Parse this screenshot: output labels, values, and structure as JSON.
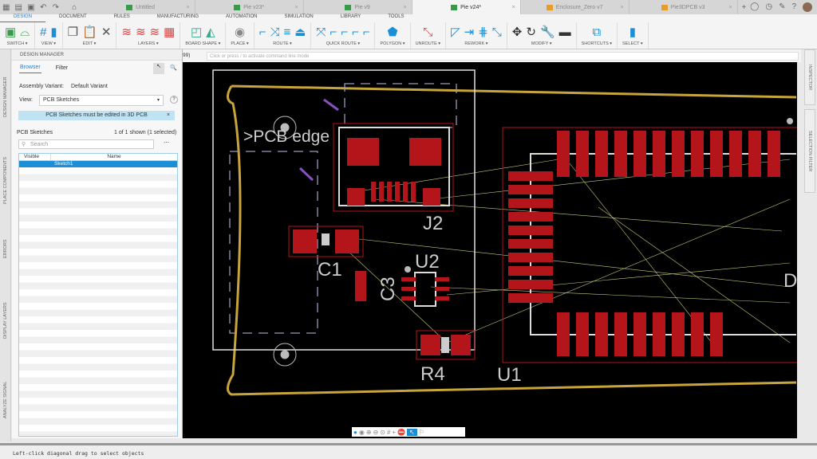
{
  "tabs": [
    {
      "label": "Untitled",
      "active": false
    },
    {
      "label": "Pie v23*",
      "active": false
    },
    {
      "label": "Pie v9",
      "active": false
    },
    {
      "label": "Pie v24*",
      "active": true
    },
    {
      "label": "Enclosure_Zero v7",
      "active": false
    },
    {
      "label": "Pie3DPCB v3",
      "active": false
    }
  ],
  "menu": [
    "DESIGN",
    "DOCUMENT",
    "RULES",
    "MANUFACTURING",
    "AUTOMATION",
    "SIMULATION",
    "LIBRARY",
    "TOOLS"
  ],
  "toolbar": [
    {
      "label": "SWITCH ▾",
      "icons": [
        "▣",
        "⌓"
      ]
    },
    {
      "label": "VIEW ▾",
      "icons": [
        "#",
        "▮"
      ]
    },
    {
      "label": "EDIT ▾",
      "icons": [
        "❐",
        "📋",
        "✕"
      ]
    },
    {
      "label": "LAYERS ▾",
      "icons": [
        "≋",
        "≋",
        "≋",
        "▦"
      ]
    },
    {
      "label": "BOARD SHAPE ▾",
      "icons": [
        "◰",
        "◭"
      ]
    },
    {
      "label": "PLACE ▾",
      "icons": [
        "◉"
      ]
    },
    {
      "label": "ROUTE ▾",
      "icons": [
        "⌐",
        "⤨",
        "≡",
        "⏏"
      ]
    },
    {
      "label": "QUICK ROUTE ▾",
      "icons": [
        "⤧",
        "⌐",
        "⌐",
        "⌐",
        "⌐"
      ]
    },
    {
      "label": "POLYGON ▾",
      "icons": [
        "⬟"
      ]
    },
    {
      "label": "UNROUTE ▾",
      "icons": [
        "⤡"
      ]
    },
    {
      "label": "REWORK ▾",
      "icons": [
        "◸",
        "⇥",
        "⋕",
        "⤡"
      ]
    },
    {
      "label": "MODIFY ▾",
      "icons": [
        "✥",
        "↻",
        "🔧",
        "▬"
      ]
    },
    {
      "label": "SHORTCUTS ▾",
      "icons": [
        "⧉"
      ]
    },
    {
      "label": "SELECT ▾",
      "icons": [
        "▮"
      ]
    }
  ],
  "left_tabs": [
    "DESIGN MANAGER",
    "PLACE COMPONENTS",
    "ERRORS",
    "DISPLAY LAYERS",
    "ANALYZE SIGNAL"
  ],
  "right_tabs": [
    "INSPECTOR",
    "SELECTION FILTER"
  ],
  "panel": {
    "title": "DESIGN MANAGER",
    "tabs": [
      "Browser",
      "Filter"
    ],
    "assembly_label": "Assembly Variant:",
    "assembly_value": "Default Variant",
    "view_label": "View:",
    "view_value": "PCB Sketches",
    "info": "PCB Sketches must be edited in 3D PCB",
    "section": "PCB Sketches",
    "count": "1 of 1 shown (1 selected)",
    "search_placeholder": "Search",
    "col_visible": "Visible",
    "col_name": "Name",
    "rows": [
      "Sketch1"
    ]
  },
  "command": {
    "prefix": "99)",
    "placeholder": "Click or press / to activate command line mode"
  },
  "canvas": {
    "labels": {
      "edge": ">PCB edge",
      "j2": "J2",
      "c1": "C1",
      "u2": "U2",
      "c3": "C3",
      "r4": "R4",
      "u1": "U1",
      "d": "D"
    },
    "colors": {
      "board": "#c8a53a",
      "pad": "#b3151a",
      "silk": "#cfcfcf",
      "airwire": "#c8c87a",
      "bg": "#000000"
    }
  },
  "status": "Left-click diagonal drag to select objects"
}
